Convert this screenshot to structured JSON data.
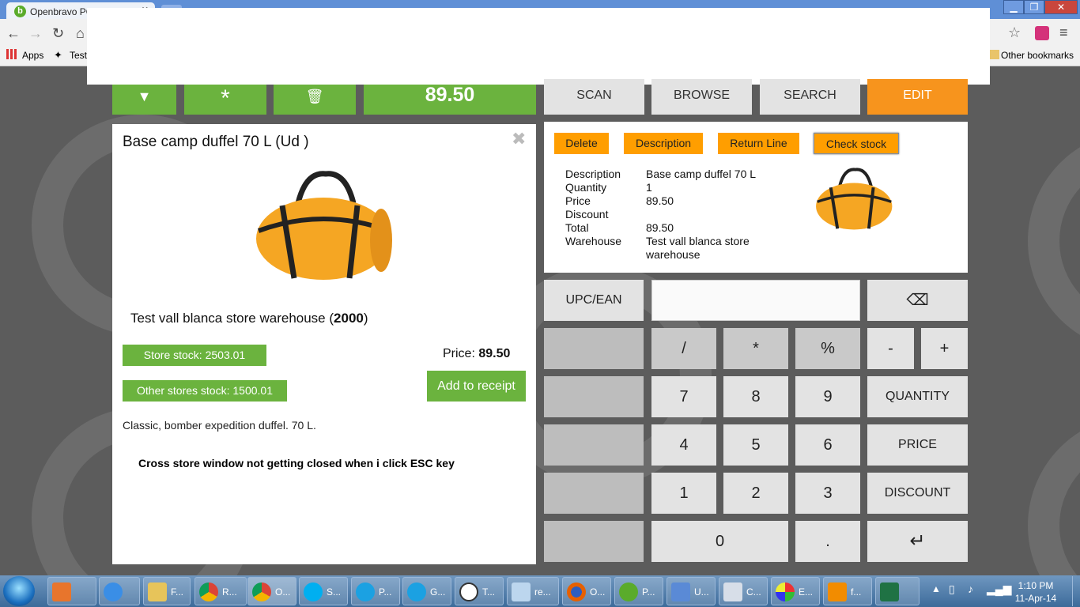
{
  "browser": {
    "tab_title": "Openbravo POS",
    "bookmarks": [
      "Apps",
      "Test"
    ],
    "other_bookmarks": "Other bookmarks"
  },
  "toolbar": {
    "total": "89.50",
    "scan": "SCAN",
    "browse": "BROWSE",
    "search": "SEARCH",
    "edit": "EDIT"
  },
  "product_panel": {
    "title": "Base camp duffel 70 L (Ud )",
    "warehouse_text": "Test vall blanca store warehouse (",
    "warehouse_qty": "2000",
    "warehouse_close": ")",
    "store_stock": "Store stock: 2503.01",
    "other_stock": "Other stores stock: 1500.01",
    "price_label": "Price: ",
    "price_value": "89.50",
    "add_button": "Add to receipt",
    "description": "Classic, bomber expedition duffel. 70 L.",
    "note": "Cross store window not getting closed when i click ESC key"
  },
  "edit_panel": {
    "buttons": [
      "Delete",
      "Description",
      "Return Line",
      "Check stock"
    ],
    "labels": [
      "Description",
      "Quantity",
      "Price",
      "Discount",
      "Total",
      "Warehouse"
    ],
    "values": [
      "Base camp duffel 70 L",
      "1",
      "89.50",
      "",
      "89.50",
      "Test vall blanca store",
      "warehouse"
    ]
  },
  "keypad": {
    "upc": "UPC/EAN",
    "input_value": "",
    "ops": [
      "/",
      "*",
      "%",
      "-",
      "+"
    ],
    "digits": [
      "7",
      "8",
      "9",
      "4",
      "5",
      "6",
      "1",
      "2",
      "3",
      "0",
      "."
    ],
    "quantity": "QUANTITY",
    "price": "PRICE",
    "discount": "DISCOUNT"
  },
  "taskbar": {
    "items": [
      "F...",
      "R...",
      "O...",
      "S...",
      "P...",
      "G...",
      "T...",
      "re...",
      "O...",
      "P...",
      "U...",
      "C...",
      "E...",
      "f..."
    ],
    "time": "1:10 PM",
    "date": "11-Apr-14"
  },
  "colors": {
    "green": "#6bb33e",
    "orange": "#f7941d",
    "amber": "#ff9e00"
  }
}
